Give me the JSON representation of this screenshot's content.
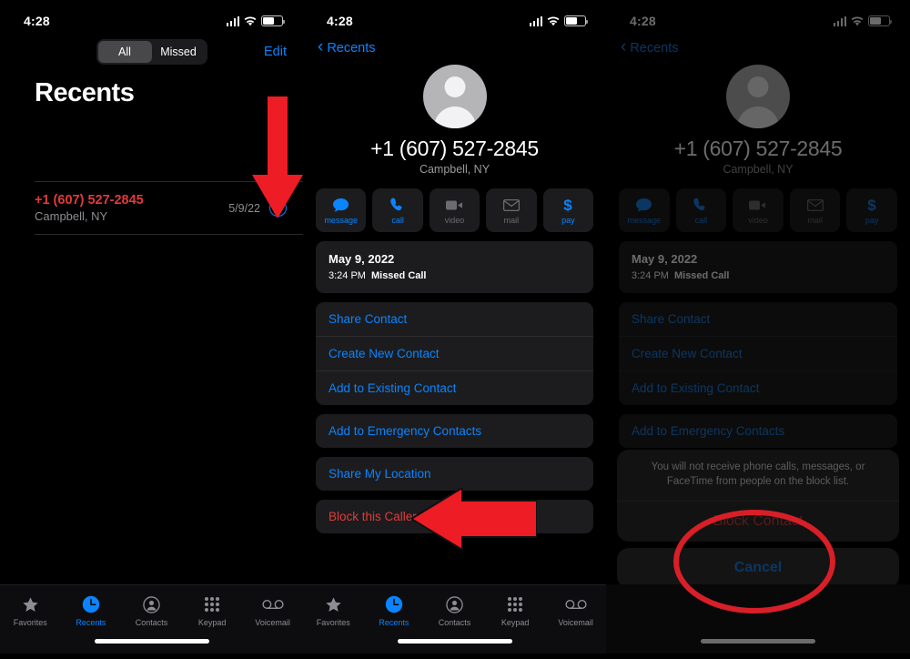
{
  "status_bar": {
    "time": "4:28",
    "signal_icon": "cellular-signal-icon",
    "wifi_icon": "wifi-icon",
    "battery_icon": "battery-icon"
  },
  "panel1": {
    "segmented": {
      "options": [
        "All",
        "Missed"
      ],
      "selected": "All"
    },
    "edit_label": "Edit",
    "page_title": "Recents",
    "call": {
      "number": "+1 (607) 527-2845",
      "place": "Campbell, NY",
      "date": "5/9/22",
      "info_glyph": "i"
    }
  },
  "panel2": {
    "back_label": "Recents",
    "number": "+1 (607) 527-2845",
    "place": "Campbell, NY",
    "actions": [
      {
        "label": "message",
        "icon": "message-bubble-icon",
        "enabled": true
      },
      {
        "label": "call",
        "icon": "phone-handset-icon",
        "enabled": true
      },
      {
        "label": "video",
        "icon": "video-camera-icon",
        "enabled": false
      },
      {
        "label": "mail",
        "icon": "envelope-icon",
        "enabled": false
      },
      {
        "label": "pay",
        "icon": "dollar-sign-icon",
        "enabled": true
      }
    ],
    "history": {
      "date": "May 9, 2022",
      "time": "3:24 PM",
      "type": "Missed Call"
    },
    "group_a": [
      "Share Contact",
      "Create New Contact",
      "Add to Existing Contact"
    ],
    "group_b": [
      "Add to Emergency Contacts"
    ],
    "group_c": [
      "Share My Location"
    ],
    "group_d": [
      "Block this Caller"
    ]
  },
  "panel3": {
    "back_label": "Recents",
    "number": "+1 (607) 527-2845",
    "place": "Campbell, NY",
    "actions": [
      {
        "label": "message",
        "icon": "message-bubble-icon",
        "enabled": true
      },
      {
        "label": "call",
        "icon": "phone-handset-icon",
        "enabled": true
      },
      {
        "label": "video",
        "icon": "video-camera-icon",
        "enabled": false
      },
      {
        "label": "mail",
        "icon": "envelope-icon",
        "enabled": false
      },
      {
        "label": "pay",
        "icon": "dollar-sign-icon",
        "enabled": true
      }
    ],
    "history": {
      "date": "May 9, 2022",
      "time": "3:24 PM",
      "type": "Missed Call"
    },
    "group_a": [
      "Share Contact",
      "Create New Contact",
      "Add to Existing Contact"
    ],
    "group_b": [
      "Add to Emergency Contacts"
    ],
    "group_c": [
      "Share My Location"
    ],
    "sheet": {
      "message": "You will not receive phone calls, messages, or FaceTime from people on the block list.",
      "confirm": "Block Contact",
      "cancel": "Cancel"
    }
  },
  "tabbar": {
    "items": [
      {
        "label": "Favorites",
        "icon": "star-icon",
        "active": false
      },
      {
        "label": "Recents",
        "icon": "clock-icon",
        "active": true
      },
      {
        "label": "Contacts",
        "icon": "person-circle-icon",
        "active": false
      },
      {
        "label": "Keypad",
        "icon": "keypad-grid-icon",
        "active": false
      },
      {
        "label": "Voicemail",
        "icon": "voicemail-icon",
        "active": false
      }
    ]
  },
  "annotations": [
    {
      "name": "down-arrow-to-info-button",
      "shape": "arrow-down",
      "color": "#ee1c25"
    },
    {
      "name": "left-arrow-to-block-this-caller",
      "shape": "arrow-left",
      "color": "#ee1c25"
    },
    {
      "name": "ellipse-around-block-contact",
      "shape": "ellipse",
      "color": "#d81f28"
    }
  ],
  "colors": {
    "accent_blue": "#0a84ff",
    "danger_red": "#e03b3b",
    "annotation_red": "#ee1c25",
    "background": "#000000",
    "card": "#1c1c1e"
  }
}
